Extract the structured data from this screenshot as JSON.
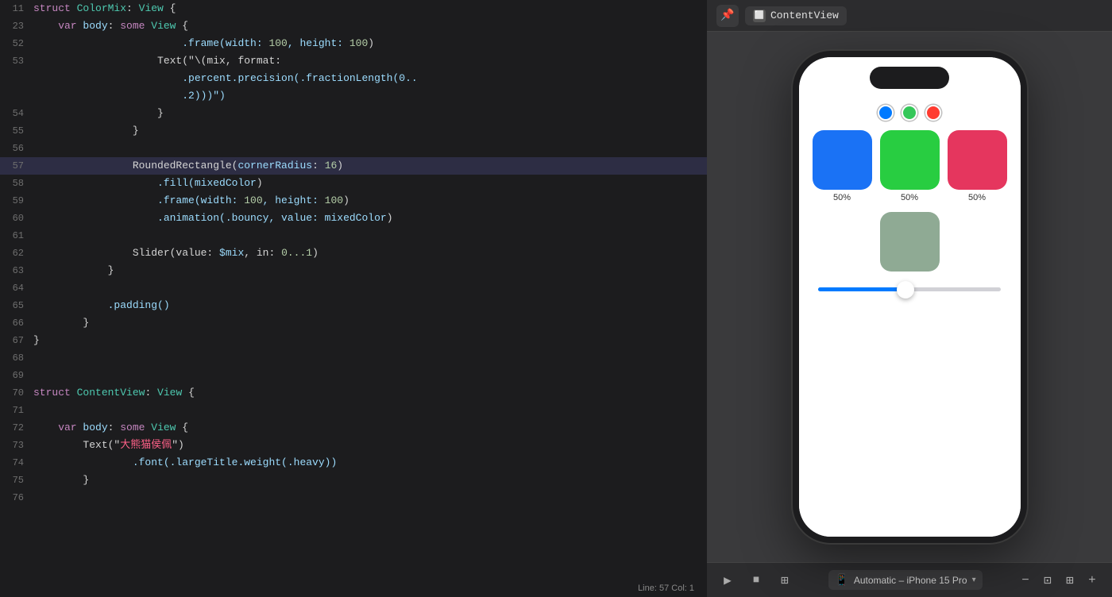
{
  "editor": {
    "lines": [
      {
        "num": "11",
        "highlighted": false,
        "tokens": [
          {
            "t": "struct ",
            "c": "kw-struct"
          },
          {
            "t": "ColorMix",
            "c": "kw-type"
          },
          {
            "t": ": ",
            "c": "kw-plain"
          },
          {
            "t": "View",
            "c": "kw-type"
          },
          {
            "t": " {",
            "c": "kw-plain"
          }
        ]
      },
      {
        "num": "23",
        "highlighted": false,
        "tokens": [
          {
            "t": "    var ",
            "c": "kw-purple"
          },
          {
            "t": "body",
            "c": "kw-lightblue"
          },
          {
            "t": ": ",
            "c": "kw-plain"
          },
          {
            "t": "some ",
            "c": "kw-purple"
          },
          {
            "t": "View",
            "c": "kw-type"
          },
          {
            "t": " {",
            "c": "kw-plain"
          }
        ]
      },
      {
        "num": "52",
        "highlighted": false,
        "tokens": [
          {
            "t": "                        .frame(width: ",
            "c": "kw-lightblue"
          },
          {
            "t": "100",
            "c": "kw-number"
          },
          {
            "t": ", height: ",
            "c": "kw-lightblue"
          },
          {
            "t": "100",
            "c": "kw-number"
          },
          {
            "t": ")",
            "c": "kw-plain"
          }
        ]
      },
      {
        "num": "53",
        "highlighted": false,
        "tokens": [
          {
            "t": "                    Text(\"\\(mix, format:",
            "c": "kw-plain"
          },
          {
            "t": "",
            "c": ""
          }
        ]
      },
      {
        "num": "",
        "highlighted": false,
        "tokens": [
          {
            "t": "                        .percent.precision(.fractionLength(0..",
            "c": "kw-lightblue"
          }
        ]
      },
      {
        "num": "",
        "highlighted": false,
        "tokens": [
          {
            "t": "                        .2)))\")",
            "c": "kw-lightblue"
          }
        ]
      },
      {
        "num": "54",
        "highlighted": false,
        "tokens": [
          {
            "t": "                    }",
            "c": "kw-plain"
          }
        ]
      },
      {
        "num": "55",
        "highlighted": false,
        "tokens": [
          {
            "t": "                }",
            "c": "kw-plain"
          }
        ]
      },
      {
        "num": "56",
        "highlighted": false,
        "tokens": []
      },
      {
        "num": "57",
        "highlighted": true,
        "tokens": [
          {
            "t": "                RoundedRectangle(",
            "c": "kw-plain"
          },
          {
            "t": "cornerRadius",
            "c": "kw-lightblue"
          },
          {
            "t": ": ",
            "c": "kw-plain"
          },
          {
            "t": "16",
            "c": "kw-number"
          },
          {
            "t": ")",
            "c": "kw-plain"
          }
        ]
      },
      {
        "num": "58",
        "highlighted": false,
        "tokens": [
          {
            "t": "                    .fill(",
            "c": "kw-lightblue"
          },
          {
            "t": "mixedColor",
            "c": "kw-lightblue"
          },
          {
            "t": ")",
            "c": "kw-plain"
          }
        ]
      },
      {
        "num": "59",
        "highlighted": false,
        "tokens": [
          {
            "t": "                    .frame(width: ",
            "c": "kw-lightblue"
          },
          {
            "t": "100",
            "c": "kw-number"
          },
          {
            "t": ", height: ",
            "c": "kw-lightblue"
          },
          {
            "t": "100",
            "c": "kw-number"
          },
          {
            "t": ")",
            "c": "kw-plain"
          }
        ]
      },
      {
        "num": "60",
        "highlighted": false,
        "tokens": [
          {
            "t": "                    .animation(.bouncy, value: ",
            "c": "kw-lightblue"
          },
          {
            "t": "mixedColor",
            "c": "kw-lightblue"
          },
          {
            "t": ")",
            "c": "kw-plain"
          }
        ]
      },
      {
        "num": "61",
        "highlighted": false,
        "tokens": []
      },
      {
        "num": "62",
        "highlighted": false,
        "tokens": [
          {
            "t": "                Slider(value: ",
            "c": "kw-plain"
          },
          {
            "t": "$mix",
            "c": "kw-lightblue"
          },
          {
            "t": ", in: ",
            "c": "kw-plain"
          },
          {
            "t": "0...1",
            "c": "kw-number"
          },
          {
            "t": ")",
            "c": "kw-plain"
          }
        ]
      },
      {
        "num": "63",
        "highlighted": false,
        "tokens": [
          {
            "t": "            }",
            "c": "kw-plain"
          }
        ]
      },
      {
        "num": "64",
        "highlighted": false,
        "tokens": []
      },
      {
        "num": "65",
        "highlighted": false,
        "tokens": [
          {
            "t": "            .padding()",
            "c": "kw-lightblue"
          }
        ]
      },
      {
        "num": "66",
        "highlighted": false,
        "tokens": [
          {
            "t": "        }",
            "c": "kw-plain"
          }
        ]
      },
      {
        "num": "67",
        "highlighted": false,
        "tokens": [
          {
            "t": "}",
            "c": "kw-plain"
          }
        ]
      },
      {
        "num": "68",
        "highlighted": false,
        "tokens": []
      },
      {
        "num": "69",
        "highlighted": false,
        "tokens": []
      },
      {
        "num": "70",
        "highlighted": false,
        "tokens": [
          {
            "t": "struct ",
            "c": "kw-struct"
          },
          {
            "t": "ContentView",
            "c": "kw-type"
          },
          {
            "t": ": ",
            "c": "kw-plain"
          },
          {
            "t": "View",
            "c": "kw-type"
          },
          {
            "t": " {",
            "c": "kw-plain"
          }
        ]
      },
      {
        "num": "71",
        "highlighted": false,
        "tokens": []
      },
      {
        "num": "72",
        "highlighted": false,
        "tokens": [
          {
            "t": "    var ",
            "c": "kw-purple"
          },
          {
            "t": "body",
            "c": "kw-lightblue"
          },
          {
            "t": ": ",
            "c": "kw-plain"
          },
          {
            "t": "some ",
            "c": "kw-purple"
          },
          {
            "t": "View",
            "c": "kw-type"
          },
          {
            "t": " {",
            "c": "kw-plain"
          }
        ]
      },
      {
        "num": "73",
        "highlighted": false,
        "tokens": [
          {
            "t": "        Text(\"",
            "c": "kw-plain"
          },
          {
            "t": "大熊猫侯佩",
            "c": "kw-pink"
          },
          {
            "t": "\")",
            "c": "kw-plain"
          }
        ]
      },
      {
        "num": "74",
        "highlighted": false,
        "tokens": [
          {
            "t": "                .font(.largeTitle.weight(.heavy))",
            "c": "kw-lightblue"
          }
        ]
      },
      {
        "num": "75",
        "highlighted": false,
        "tokens": [
          {
            "t": "        }",
            "c": "kw-plain"
          }
        ]
      },
      {
        "num": "76",
        "highlighted": false,
        "tokens": []
      }
    ]
  },
  "preview": {
    "tab_label": "ContentView",
    "tab_icon": "⬜",
    "pin_icon": "📌",
    "color_circles": [
      {
        "color": "#007aff",
        "name": "blue-circle"
      },
      {
        "color": "#34c759",
        "name": "green-circle"
      },
      {
        "color": "#ff3b30",
        "name": "red-circle"
      }
    ],
    "color_boxes": [
      {
        "color": "#1a72f5",
        "label": "50%",
        "name": "blue-box"
      },
      {
        "color": "#28cd41",
        "label": "50%",
        "name": "green-box"
      },
      {
        "color": "#e5365e",
        "label": "50%",
        "name": "red-box"
      }
    ],
    "mixed_color": "#8faa94",
    "slider_fill_pct": 48,
    "device_label": "Automatic – iPhone 15 Pro",
    "status_label": "Line: 57  Col: 1",
    "bottom_icons": [
      "▶",
      "⏹",
      "⊞"
    ],
    "zoom_icons": [
      "-",
      "+",
      "⊡",
      "⊞"
    ]
  }
}
